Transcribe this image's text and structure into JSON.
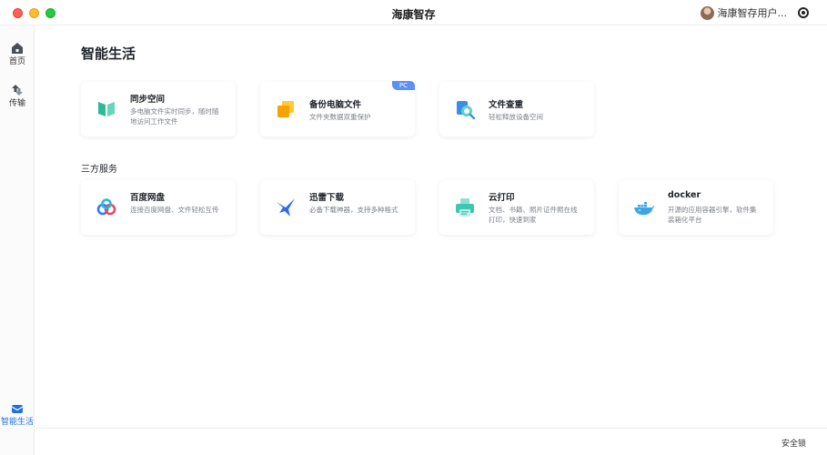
{
  "window": {
    "title": "海康智存"
  },
  "user": {
    "name": "海康智存用户..."
  },
  "sidebar": {
    "items": [
      {
        "label": "首页",
        "icon": "home-icon"
      },
      {
        "label": "传输",
        "icon": "transfer-icon"
      },
      {
        "label": "智能生活",
        "icon": "smart-life-icon",
        "active": true
      }
    ]
  },
  "main": {
    "title": "智能生活",
    "cards": [
      {
        "title": "同步空间",
        "desc": "多电脑文件实时同步，随时随地访问工作文件",
        "icon": "sync-icon"
      },
      {
        "title": "备份电脑文件",
        "desc": "文件夹数据双重保护",
        "icon": "backup-icon",
        "badge": "PC"
      },
      {
        "title": "文件查重",
        "desc": "轻松释放设备空间",
        "icon": "dedup-icon"
      }
    ],
    "third_party": {
      "title": "三方服务",
      "cards": [
        {
          "title": "百度网盘",
          "desc": "连接百度网盘、文件轻松互传",
          "icon": "baidu-icon"
        },
        {
          "title": "迅雷下载",
          "desc": "必备下载神器，支持多种格式",
          "icon": "xunlei-icon"
        },
        {
          "title": "云打印",
          "desc": "文档、书籍、照片证件照在线打印，快速到家",
          "icon": "printer-icon"
        },
        {
          "title": "docker",
          "desc": "开源的应用容器引擎，软件集装箱化平台",
          "icon": "docker-icon"
        }
      ]
    }
  },
  "footer": {
    "lock_label": "安全锁"
  },
  "colors": {
    "accent": "#1f6fe5",
    "badge": "#5b8ff9",
    "sync": "#3cc7a5",
    "backup": "#f5b400",
    "docker": "#3aa6e8"
  }
}
